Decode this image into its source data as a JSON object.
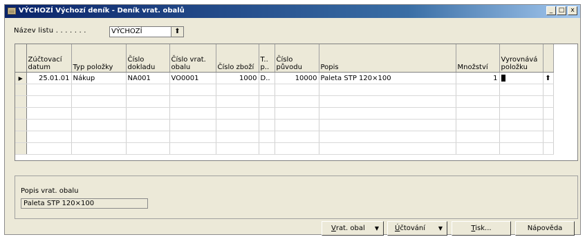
{
  "window": {
    "title": "VÝCHOZÍ Výchozí deník - Deník vrat. obalů",
    "minimize_glyph": "_",
    "restore_glyph": "□",
    "close_glyph": "x"
  },
  "sheet": {
    "label": "Název listu . . . . . . .",
    "value": "VÝCHOZÍ",
    "lookup_glyph": "⬆"
  },
  "grid": {
    "columns": [
      "Zúčtovací datum",
      "Typ položky",
      "Číslo dokladu",
      "Číslo vrat. obalu",
      "Číslo zboží",
      "T.. p..",
      "Číslo původu",
      "Popis",
      "Množství",
      "Vyrovnává položku"
    ],
    "rows": [
      {
        "marker": "▶",
        "date": "25.01.01",
        "type": "Nákup",
        "doc": "NA001",
        "pack": "VO0001",
        "item": "1000",
        "tp": "D..",
        "origin": "10000",
        "desc": "Paleta STP 120×100",
        "qty": "1",
        "apply": "",
        "lookup_glyph": "⬆"
      }
    ],
    "empty_row_count": 6,
    "scroll_up_glyph": "▲",
    "scroll_down_glyph": "▼"
  },
  "panel": {
    "label": "Popis vrat. obalu",
    "value": "Paleta STP 120×100"
  },
  "buttons": {
    "vrat_obal": {
      "mnemonic": "V",
      "rest": "rat. obal",
      "arrow": "▼"
    },
    "uctovani": {
      "mnemonic": "Ú",
      "rest": "čtování",
      "arrow": "▼"
    },
    "tisk": {
      "mnemonic": "T",
      "rest": "isk...",
      "arrow": ""
    },
    "napoveda": {
      "mnemonic": "",
      "rest": "Nápověda",
      "arrow": ""
    }
  },
  "colors": {
    "title_gradient_start": "#0a246a",
    "title_gradient_end": "#a6caf0",
    "window_face": "#ece9d8"
  },
  "icons": {
    "window": "journal-window-icon",
    "lookup": "lookup-arrow-icon",
    "row_pointer": "current-row-triangle-icon"
  }
}
